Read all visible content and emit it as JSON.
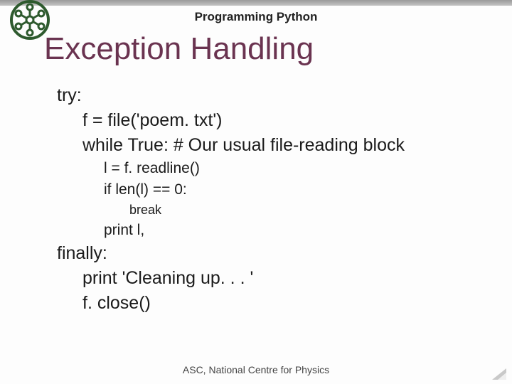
{
  "header": {
    "title": "Programming Python"
  },
  "page_title": "Exception Handling",
  "code": {
    "l1": "try:",
    "l2": "f = file('poem. txt')",
    "l3": "while True: # Our usual file-reading block",
    "l4": "l = f. readline()",
    "l5": "if len(l) == 0:",
    "l6": "break",
    "l7": "print l,",
    "l8": "finally:",
    "l9": "print 'Cleaning up. . . '",
    "l10": "f. close()"
  },
  "footer": "ASC, National Centre for Physics"
}
